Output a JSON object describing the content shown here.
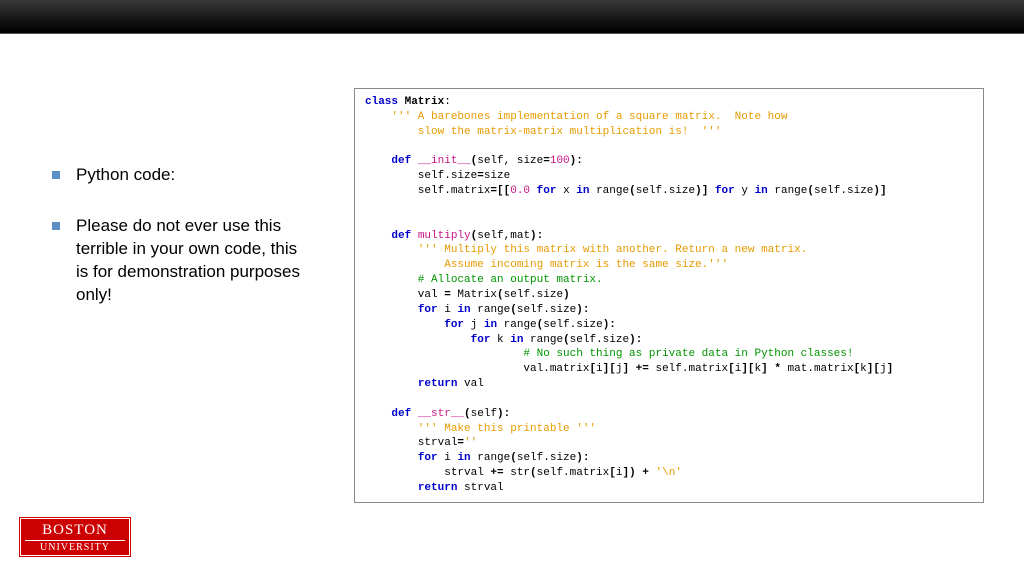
{
  "bullets": [
    "Python code:",
    "Please do not ever use this terrible in your own code, this is for demonstration purposes only!"
  ],
  "logo": {
    "line1": "BOSTON",
    "line2": "UNIVERSITY"
  },
  "code": {
    "l01_kw": "class ",
    "l01_name": "Matrix",
    "l01_tail": ":",
    "l02": "    ''' A barebones implementation of a square matrix.  Note how",
    "l03": "        slow the matrix-matrix multiplication is!  '''",
    "l04_def": "    def ",
    "l04_fn": "__init__",
    "l04_op1": "(",
    "l04_args": "self, size",
    "l04_eq": "=",
    "l04_num": "100",
    "l04_op2": "):",
    "l05a": "        self.size",
    "l05b": "=",
    "l05c": "size",
    "l06a": "        self.matrix",
    "l06b": "=[[",
    "l06num": "0.0",
    "l06c": " ",
    "l06for1": "for",
    "l06d": " x ",
    "l06in1": "in",
    "l06e": " range",
    "l06f": "(",
    "l06g": "self.size",
    "l06h": ")] ",
    "l06for2": "for",
    "l06i": " y ",
    "l06in2": "in",
    "l06j": " range",
    "l06k": "(",
    "l06l": "self.size",
    "l06m": ")]",
    "l08_def": "    def ",
    "l08_fn": "multiply",
    "l08_op1": "(",
    "l08_args": "self,mat",
    "l08_op2": "):",
    "l09": "        ''' Multiply this matrix with another. Return a new matrix.",
    "l10": "            Assume incoming matrix is the same size.'''",
    "l11": "        # Allocate an output matrix.",
    "l12a": "        val ",
    "l12b": "=",
    "l12c": " Matrix",
    "l12d": "(",
    "l12e": "self.size",
    "l12f": ")",
    "l13a": "        ",
    "l13for": "for",
    "l13b": " i ",
    "l13in": "in",
    "l13c": " range",
    "l13d": "(",
    "l13e": "self.size",
    "l13f": "):",
    "l14a": "            ",
    "l14for": "for",
    "l14b": " j ",
    "l14in": "in",
    "l14c": " range",
    "l14d": "(",
    "l14e": "self.size",
    "l14f": "):",
    "l15a": "                ",
    "l15for": "for",
    "l15b": " k ",
    "l15in": "in",
    "l15c": " range",
    "l15d": "(",
    "l15e": "self.size",
    "l15f": "):",
    "l16": "                        # No such thing as private data in Python classes!",
    "l17a": "                        val.matrix",
    "l17b": "[",
    "l17c": "i",
    "l17d": "][",
    "l17e": "j",
    "l17f": "] ",
    "l17g": "+=",
    "l17h": " self.matrix",
    "l17i": "[",
    "l17j": "i",
    "l17k": "][",
    "l17l": "k",
    "l17m": "] ",
    "l17n": "*",
    "l17o": " mat.matrix",
    "l17p": "[",
    "l17q": "k",
    "l17r": "][",
    "l17s": "j",
    "l17t": "]",
    "l18a": "        ",
    "l18ret": "return",
    "l18b": " val",
    "l20_def": "    def ",
    "l20_fn": "__str__",
    "l20_op1": "(",
    "l20_args": "self",
    "l20_op2": "):",
    "l21": "        ''' Make this printable '''",
    "l22a": "        strval",
    "l22b": "=",
    "l22c": "''",
    "l23a": "        ",
    "l23for": "for",
    "l23b": " i ",
    "l23in": "in",
    "l23c": " range",
    "l23d": "(",
    "l23e": "self.size",
    "l23f": "):",
    "l24a": "            strval ",
    "l24b": "+=",
    "l24c": " str",
    "l24d": "(",
    "l24e": "self.matrix",
    "l24f": "[",
    "l24g": "i",
    "l24h": "]) ",
    "l24i": "+",
    "l24j": " ",
    "l24k": "'\\n'",
    "l25a": "        ",
    "l25ret": "return",
    "l25b": " strval"
  }
}
